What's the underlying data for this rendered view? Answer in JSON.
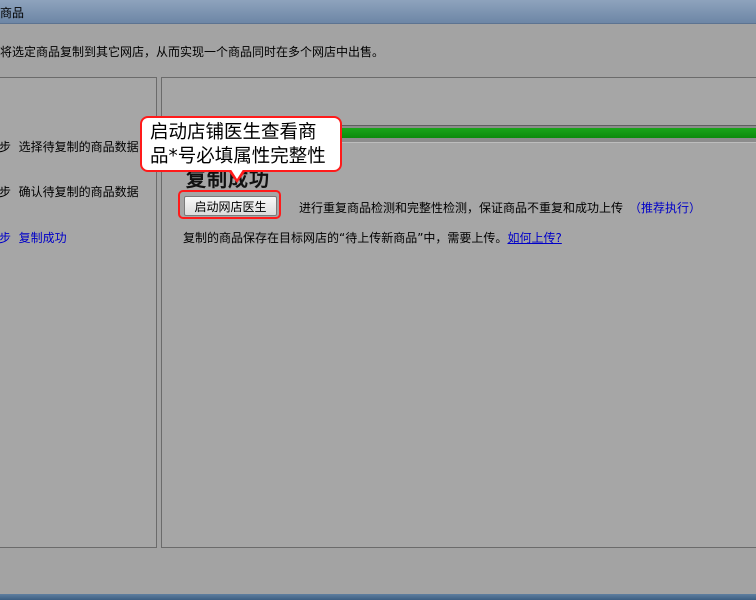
{
  "window": {
    "title": "商品"
  },
  "description": "将选定商品复制到其它网店，从而实现一个商品同时在多个网店中出售。",
  "steps": [
    {
      "num": "步",
      "label": "选择待复制的商品数据"
    },
    {
      "num": "步",
      "label": "确认待复制的商品数据"
    },
    {
      "num": "步",
      "label": "复制成功"
    }
  ],
  "progress": {
    "percent": 100
  },
  "result": {
    "title": "复制成功",
    "doctor_button": "启动网店医生",
    "check_text": "进行重复商品检测和完整性检测，保证商品不重复和成功上传",
    "recommend": "（推荐执行）",
    "saved_text": "复制的商品保存在目标网店的“待上传新商品”中，需要上传。",
    "howto_link": "如何上传?"
  },
  "tooltip": {
    "line1": "启动店铺医生查看商",
    "line2": "品*号必填属性完整性"
  },
  "colors": {
    "accent_green": "#0c8a0c",
    "link_blue": "#0000c8",
    "highlight_red": "#ff1a1a"
  }
}
